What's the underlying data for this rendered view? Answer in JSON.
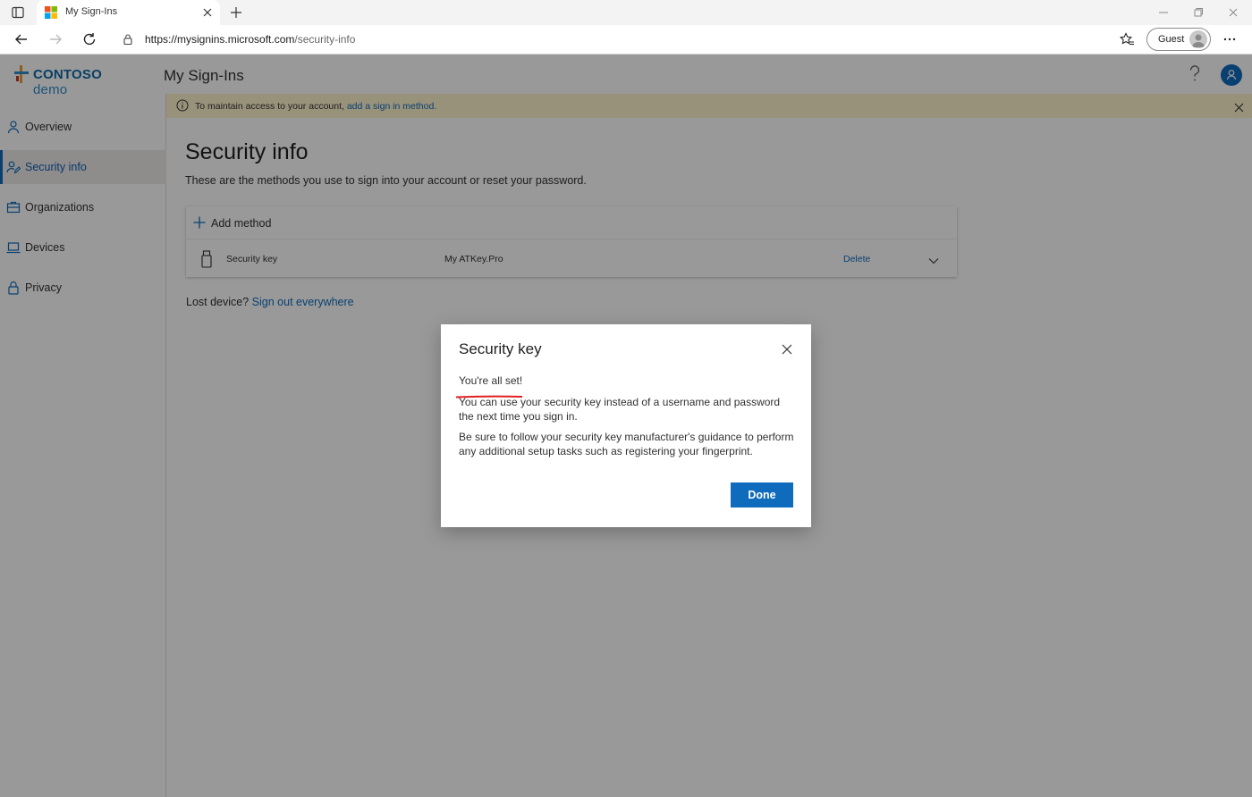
{
  "browser": {
    "tab_title": "My Sign-Ins",
    "url_host": "https://mysignins.microsoft.com",
    "url_path": "/security-info",
    "profile_label": "Guest"
  },
  "header": {
    "logo_bold": "CONTOSO",
    "logo_light": " demo",
    "app_title": "My Sign-Ins"
  },
  "sidebar": {
    "items": [
      {
        "label": "Overview",
        "icon": "person-icon"
      },
      {
        "label": "Security info",
        "icon": "security-info-icon",
        "active": true
      },
      {
        "label": "Organizations",
        "icon": "briefcase-icon"
      },
      {
        "label": "Devices",
        "icon": "laptop-icon"
      },
      {
        "label": "Privacy",
        "icon": "lock-icon"
      }
    ]
  },
  "banner": {
    "text": "To maintain access to your account, ",
    "link": "add a sign in method."
  },
  "main": {
    "title": "Security info",
    "subtitle": "These are the methods you use to sign into your account or reset your password.",
    "add_method_label": "Add method",
    "methods": [
      {
        "type": "Security key",
        "name": "My ATKey.Pro",
        "action": "Delete"
      }
    ],
    "lost_device_label": "Lost device?",
    "lost_device_link": "Sign out everywhere"
  },
  "dialog": {
    "title": "Security key",
    "heading": "You're all set!",
    "paragraph1": "You can use your security key instead of a username and password the next time you sign in.",
    "paragraph2": "Be sure to follow your security key manufacturer's guidance to perform any additional setup tasks such as registering your fingerprint.",
    "done_label": "Done"
  },
  "colors": {
    "accent": "#0f6cbd",
    "banner_bg": "#fff4ce",
    "annotation_underline": "#e02020"
  }
}
